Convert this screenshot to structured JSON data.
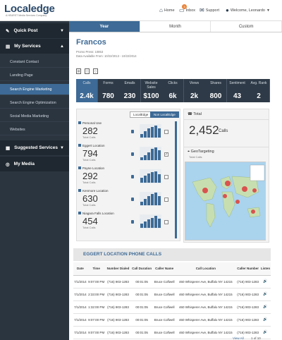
{
  "header": {
    "logo_text": "Localedge",
    "logo_sub": "A HEARST Media Services Company",
    "nav": {
      "home": "Home",
      "inbox": "Inbox",
      "inbox_count": "3",
      "support": "Support",
      "welcome": "Welcome, Leonardo"
    }
  },
  "sidebar": {
    "quick_post": "Quick Post",
    "my_services": "My Services",
    "items": [
      "Constant Contact",
      "Landing Page",
      "Search Engine Marketing",
      "Search Engine Optimization",
      "Social Media Marketing",
      "Websites"
    ],
    "suggested_services": "Suggested Services",
    "my_media": "My Media"
  },
  "tabs": [
    "Year",
    "Month",
    "Custom"
  ],
  "main": {
    "title": "Francos",
    "promo_line": "Promo Press: 10853",
    "data_line": "Data Available From: 10/22/2013 - 10/22/2014"
  },
  "metrics": [
    {
      "label": "Calls",
      "value": "2.4k"
    },
    {
      "label": "Forms",
      "value": "780"
    },
    {
      "label": "Emails",
      "value": "230"
    },
    {
      "label": "Website Sales",
      "value": "$100"
    },
    {
      "label": "Clicks",
      "value": "6k"
    },
    {
      "label": "Views",
      "value": "2k"
    },
    {
      "label": "Shares",
      "value": "800"
    },
    {
      "label": "Sentiment",
      "value": "43"
    },
    {
      "label": "Avg. Rank",
      "value": "2"
    }
  ],
  "toggles": {
    "local": "LocalEdge",
    "non_local": "Non LocalEdge"
  },
  "locations": [
    {
      "name": "Personal Use",
      "value": "282",
      "sub": "Total Calls",
      "bars": [
        0.3,
        0.5,
        0.7,
        0.85,
        0.95,
        0.75
      ]
    },
    {
      "name": "Eggert Location",
      "value": "794",
      "sub": "Total Calls",
      "bars": [
        0.2,
        0.4,
        0.6,
        0.9,
        1.0,
        0.8
      ]
    },
    {
      "name": "Payne Location",
      "value": "292",
      "sub": "Total Calls",
      "bars": [
        0.4,
        0.55,
        0.7,
        0.85,
        0.9,
        0.65
      ]
    },
    {
      "name": "Kenmore Location",
      "value": "630",
      "sub": "Total Calls",
      "bars": [
        0.3,
        0.5,
        0.75,
        0.9,
        1.0,
        0.7
      ]
    },
    {
      "name": "Niagara Falls Location",
      "value": "454",
      "sub": "Total Calls",
      "bars": [
        0.35,
        0.5,
        0.65,
        0.8,
        0.95,
        0.7
      ]
    }
  ],
  "total_card": {
    "title": "Total",
    "value": "2,452",
    "unit": "Calls"
  },
  "geo_card": {
    "title": "GeoTargeting",
    "sub": "Total Calls"
  },
  "table": {
    "title": "EGGERT LOCATION PHONE CALLS",
    "headers": [
      "Date",
      "Time",
      "Number Dialed",
      "Call Duration",
      "Caller Name",
      "Call Location",
      "Caller Number",
      "Listen"
    ],
    "rows": [
      [
        "7/1/2014",
        "9:07:00 PM",
        "(716) 903-1283",
        "00:01:05",
        "Bruce Colfwell",
        "460 Whisperer Ave, Buffalo NY 14215",
        "(716) 903-1283"
      ],
      [
        "7/1/2014",
        "2:33:00 PM",
        "(716) 903-1283",
        "00:01:05",
        "Bruce Colfwell",
        "460 Whisperer Ave, Buffalo NY 14215",
        "(716) 903-1283"
      ],
      [
        "7/1/2014",
        "1:32:00 PM",
        "(716) 903-1283",
        "00:01:05",
        "Bruce Colfwell",
        "460 Whisperer Ave, Buffalo NY 14215",
        "(716) 903-1283"
      ],
      [
        "7/1/2014",
        "9:07:00 PM",
        "(716) 903-1283",
        "00:01:05",
        "Bruce Colfwell",
        "460 Whisperer Ave, Buffalo NY 14215",
        "(716) 903-1283"
      ],
      [
        "7/1/2014",
        "9:07:00 PM",
        "(716) 903-1283",
        "00:01:05",
        "Bruce Colfwell",
        "460 Whisperer Ave, Buffalo NY 14215",
        "(716) 903-1283"
      ]
    ],
    "view_all": "View All",
    "pager": "1 of 10"
  }
}
